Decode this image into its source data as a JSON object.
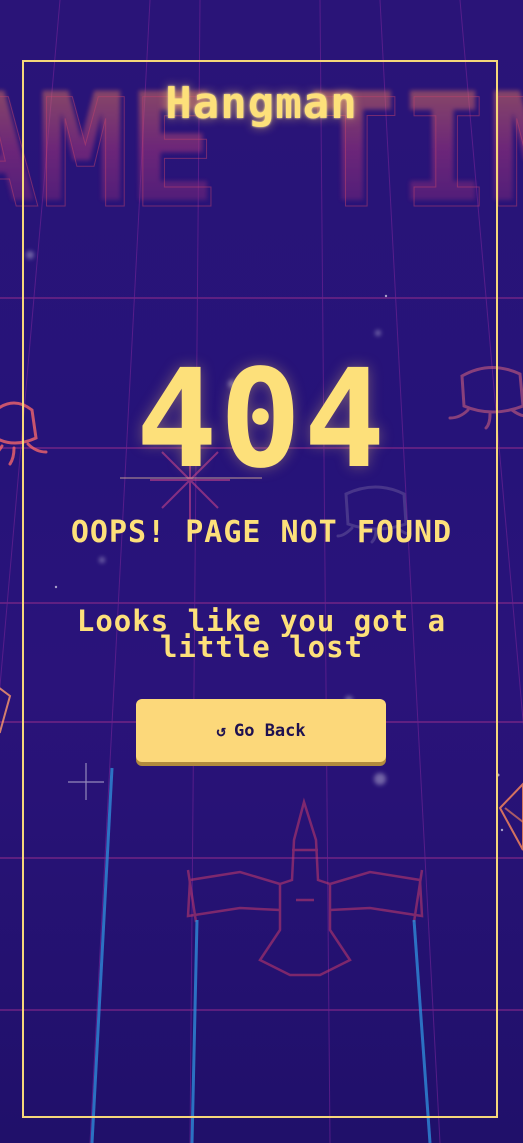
{
  "header": {
    "title": "Hangman"
  },
  "error": {
    "code": "404",
    "heading": "OOPS! PAGE NOT FOUND",
    "message": "Looks like you got a little lost"
  },
  "actions": {
    "back_label": "Go Back",
    "back_icon": "undo-arrow-icon"
  },
  "background": {
    "marquee_text": "GAME TIME"
  },
  "colors": {
    "accent": "#fde07a",
    "button_bg": "#fcd87a",
    "background": "#271377",
    "grid": "#8a2a8a"
  }
}
